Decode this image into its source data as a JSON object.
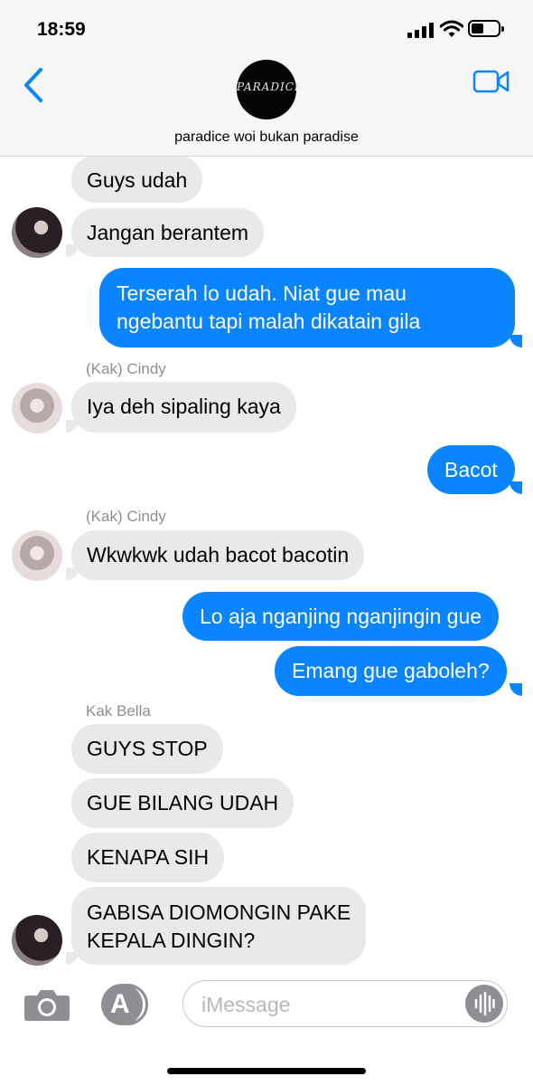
{
  "status": {
    "time": "18:59"
  },
  "header": {
    "group_name": "paradice woi bukan paradise",
    "avatar_text": "PARADICE"
  },
  "senders": {
    "cindy": "(Kak) Cindy",
    "bella": "Kak Bella"
  },
  "messages": [
    {
      "side": "in",
      "text": "Guys udah"
    },
    {
      "side": "in",
      "text": "Jangan berantem"
    },
    {
      "side": "out",
      "line1": "Terserah lo udah. Niat gue mau",
      "line2": "ngebantu tapi malah dikatain gila"
    },
    {
      "side": "in",
      "text": "Iya deh sipaling kaya"
    },
    {
      "side": "out",
      "text": "Bacot"
    },
    {
      "side": "in",
      "text": "Wkwkwk udah bacot bacotin"
    },
    {
      "side": "out",
      "text": "Lo aja nganjing nganjingin gue"
    },
    {
      "side": "out",
      "text": "Emang gue gaboleh?"
    },
    {
      "side": "in",
      "text": "GUYS STOP"
    },
    {
      "side": "in",
      "text": "GUE BILANG UDAH"
    },
    {
      "side": "in",
      "text": "KENAPA SIH"
    },
    {
      "side": "in",
      "line1": "GABISA DIOMONGIN PAKE",
      "line2": "KEPALA DINGIN?"
    }
  ],
  "input": {
    "placeholder": "iMessage"
  },
  "colors": {
    "outgoing": "#0a84ff",
    "incoming": "#e9e9eb",
    "accent": "#0a84ff"
  }
}
